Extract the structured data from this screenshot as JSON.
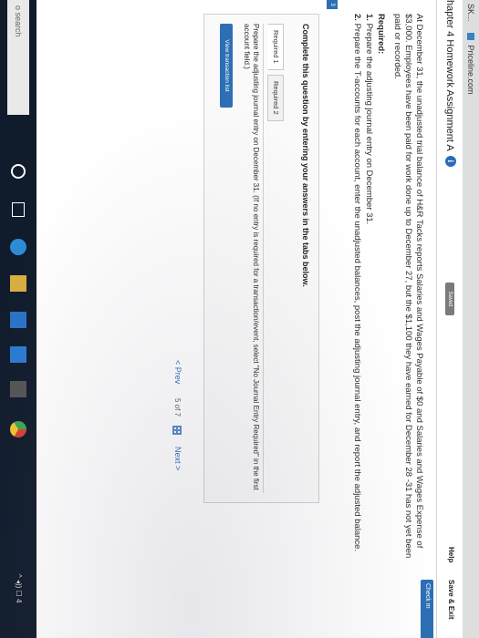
{
  "browser": {
    "tabs": [
      {
        "label": "SK..."
      },
      {
        "label": "Priceline.com"
      }
    ]
  },
  "header": {
    "title": "hapter 4 Homework Assignment A",
    "saved_label": "Saved",
    "help_label": "Help",
    "save_exit_label": "Save & Exit",
    "check_label": "Check m"
  },
  "question": {
    "number": "3",
    "problem_text": "At December 31, the unadjusted trial balance of H&R Tacks reports Salaries and Wages Payable of $0 and Salaries and Wages Expense of $3,000. Employees have been paid for work done up to December 27, but the $1,100 they have earned for December 28 -31 has not yet been paid or recorded.",
    "required_heading": "Required:",
    "required_items": [
      {
        "num": "1.",
        "text": "Prepare the adjusting journal entry on December 31."
      },
      {
        "num": "2.",
        "text": "Prepare the T-accounts for each account, enter the unadjusted balances, post the adjusting journal entry, and report the adjusted balance."
      }
    ]
  },
  "answer": {
    "instruction": "Complete this question by entering your answers in the tabs below.",
    "tabs": [
      {
        "label": "Required 1"
      },
      {
        "label": "Required 2"
      }
    ],
    "tab_instruction": "Prepare the adjusting journal entry on December 31. (If no entry is required for a transaction/event, select \"No Journal Entry Required\" in the first account field.)",
    "view_list_label": "View transaction list"
  },
  "pager": {
    "prev_label": "< Prev",
    "page_text": "5 of 7",
    "next_label": "Next >"
  },
  "taskbar": {
    "search_placeholder": "o search",
    "tray_text": "^ ◂)) ☐ 4"
  }
}
